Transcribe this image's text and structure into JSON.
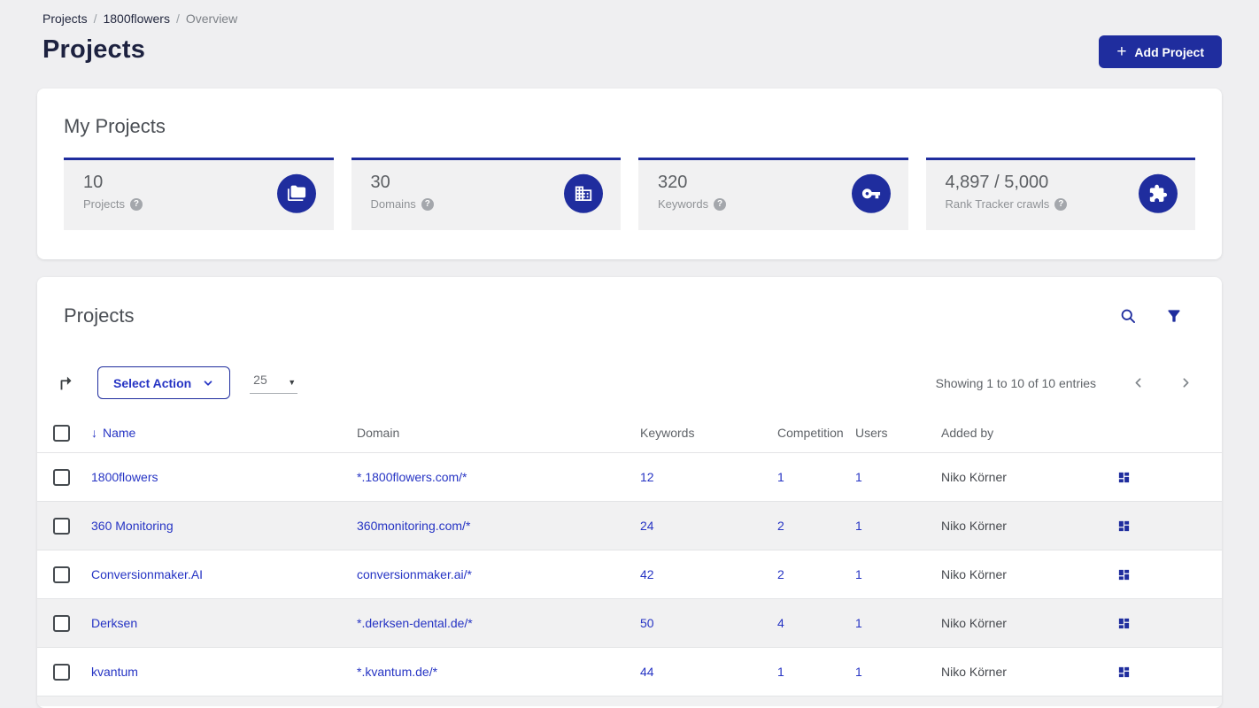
{
  "colors": {
    "primary": "#1f2d9e",
    "link": "#2634c4",
    "title": "#1d2240"
  },
  "breadcrumb": {
    "separator": "/",
    "items": [
      {
        "label": "Projects"
      },
      {
        "label": "1800flowers"
      },
      {
        "label": "Overview"
      }
    ]
  },
  "header": {
    "title": "Projects",
    "add_button": "Add Project",
    "plus": "+"
  },
  "my_projects": {
    "title": "My Projects",
    "help_glyph": "?",
    "stats": [
      {
        "value": "10",
        "label": "Projects",
        "icon": "folder-copy-icon"
      },
      {
        "value": "30",
        "label": "Domains",
        "icon": "building-icon"
      },
      {
        "value": "320",
        "label": "Keywords",
        "icon": "key-icon"
      },
      {
        "value": "4,897 / 5,000",
        "label": "Rank Tracker crawls",
        "icon": "puzzle-icon"
      }
    ]
  },
  "projects_table": {
    "title": "Projects",
    "header_icons": [
      "search-icon",
      "filter-icon"
    ],
    "toolbar": {
      "share_icon": "forward-arrow-icon",
      "select_action": "Select Action",
      "page_size": "25",
      "page_size_caret": "▼",
      "showing": "Showing 1 to 10 of 10 entries"
    },
    "columns": {
      "sort_arrow": "↓",
      "name": "Name",
      "domain": "Domain",
      "keywords": "Keywords",
      "competition": "Competition",
      "users": "Users",
      "added_by": "Added by"
    },
    "row_action_icon": "dashboard-grid-icon",
    "rows": [
      {
        "name": "1800flowers",
        "domain": "*.1800flowers.com/*",
        "keywords": "12",
        "competition": "1",
        "users": "1",
        "added_by": "Niko Körner"
      },
      {
        "name": "360 Monitoring",
        "domain": "360monitoring.com/*",
        "keywords": "24",
        "competition": "2",
        "users": "1",
        "added_by": "Niko Körner"
      },
      {
        "name": "Conversionmaker.AI",
        "domain": "conversionmaker.ai/*",
        "keywords": "42",
        "competition": "2",
        "users": "1",
        "added_by": "Niko Körner"
      },
      {
        "name": "Derksen",
        "domain": "*.derksen-dental.de/*",
        "keywords": "50",
        "competition": "4",
        "users": "1",
        "added_by": "Niko Körner"
      },
      {
        "name": "kvantum",
        "domain": "*.kvantum.de/*",
        "keywords": "44",
        "competition": "1",
        "users": "1",
        "added_by": "Niko Körner"
      }
    ]
  }
}
